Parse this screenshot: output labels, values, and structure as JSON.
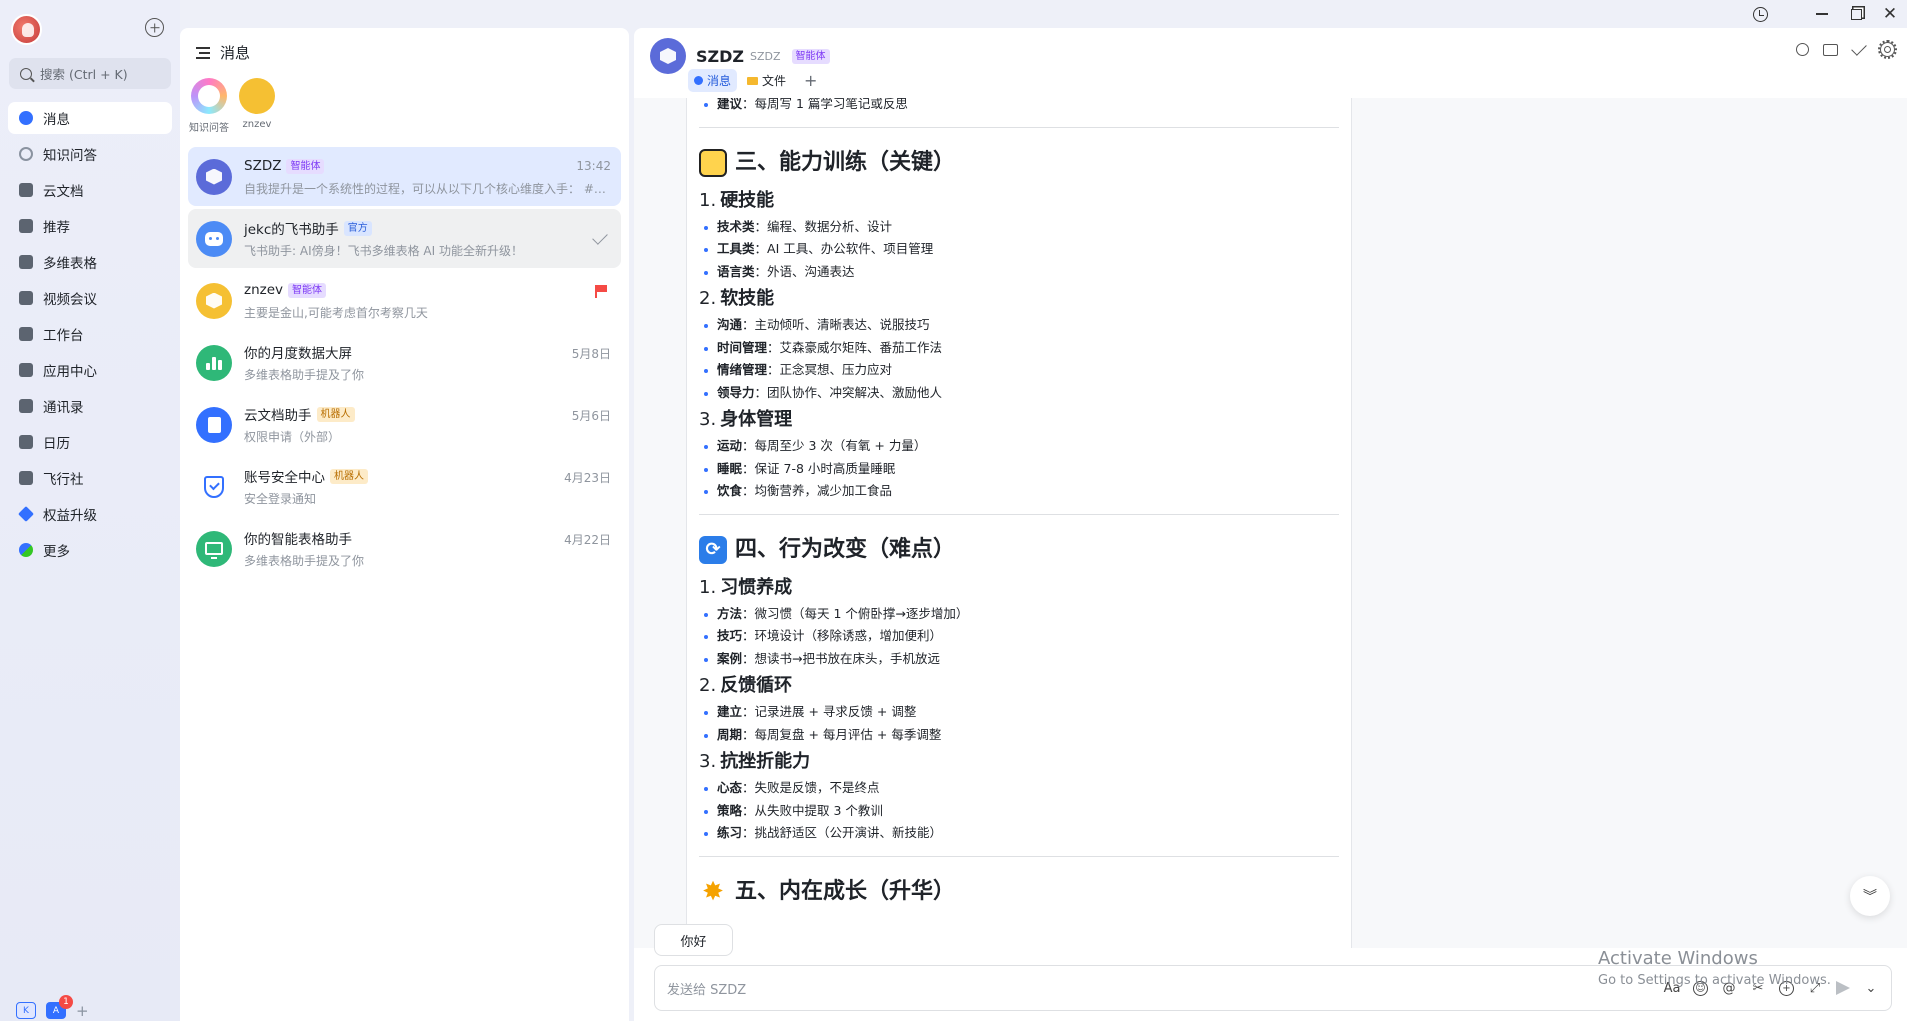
{
  "rail": {
    "search_placeholder": "搜索 (Ctrl + K)",
    "nav": [
      {
        "label": "消息",
        "icon": "chat-bubble-icon",
        "active": true
      },
      {
        "label": "知识问答",
        "icon": "knowledge-icon"
      },
      {
        "label": "云文档",
        "icon": "cloud-doc-icon"
      },
      {
        "label": "推荐",
        "icon": "recommend-icon"
      },
      {
        "label": "多维表格",
        "icon": "base-table-icon"
      },
      {
        "label": "视频会议",
        "icon": "video-meeting-icon"
      },
      {
        "label": "工作台",
        "icon": "workplace-icon"
      },
      {
        "label": "应用中心",
        "icon": "app-center-icon"
      },
      {
        "label": "通讯录",
        "icon": "contacts-icon"
      },
      {
        "label": "日历",
        "icon": "calendar-icon"
      },
      {
        "label": "飞行社",
        "icon": "flight-club-icon"
      },
      {
        "label": "权益升级",
        "icon": "diamond-icon"
      },
      {
        "label": "更多",
        "icon": "more-apps-icon"
      }
    ],
    "bottom": {
      "app1": "K",
      "app2": "A",
      "app2_badge": "1"
    }
  },
  "list": {
    "title": "消息",
    "pinned": [
      {
        "label": "知识问答"
      },
      {
        "label": "znzev"
      }
    ],
    "conversations": [
      {
        "name": "SZDZ",
        "tag": "智能体",
        "tag_style": "purple",
        "time": "13:42",
        "preview": "自我提升是一个系统性的过程，可以从以下几个核心维度入手： ## 一、认知升级（基础）",
        "color": "#5b6bd9"
      },
      {
        "name": "jekc的飞书助手",
        "tag": "官方",
        "tag_style": "blue",
        "time": "",
        "preview": "飞书助手: AI傍身！飞书多维表格 AI 功能全新升级！",
        "color": "#4c8bf5"
      },
      {
        "name": "znzev",
        "tag": "智能体",
        "tag_style": "purple",
        "time": "",
        "preview": "主要是金山,可能考虑首尔考察几天",
        "color": "#f5c033"
      },
      {
        "name": "你的月度数据大屏",
        "tag": "",
        "tag_style": "",
        "time": "5月8日",
        "preview": "多维表格助手提及了你",
        "color": "#2fb878"
      },
      {
        "name": "云文档助手",
        "tag": "机器人",
        "tag_style": "orange",
        "time": "5月6日",
        "preview": "权限申请（外部）",
        "color": "#3370ff"
      },
      {
        "name": "账号安全中心",
        "tag": "机器人",
        "tag_style": "orange",
        "time": "4月23日",
        "preview": "安全登录通知",
        "color": "#ffffff"
      },
      {
        "name": "你的智能表格助手",
        "tag": "",
        "tag_style": "",
        "time": "4月22日",
        "preview": "多维表格助手提及了你",
        "color": "#2fb878"
      }
    ]
  },
  "chat": {
    "name": "SZDZ",
    "id": "SZDZ",
    "tag": "智能体",
    "tabs": {
      "messages": "消息",
      "files": "文件"
    },
    "doc": {
      "top_item": {
        "k": "建议",
        "v": "：每周写 1 篇学习笔记或反思"
      },
      "s3": {
        "title": "三、能力训练（关键）"
      },
      "s3a": {
        "num": "1.",
        "title": "硬技能"
      },
      "s3a_items": [
        {
          "k": "技术类",
          "v": "：编程、数据分析、设计"
        },
        {
          "k": "工具类",
          "v": "：AI 工具、办公软件、项目管理"
        },
        {
          "k": "语言类",
          "v": "：外语、沟通表达"
        }
      ],
      "s3b": {
        "num": "2.",
        "title": "软技能"
      },
      "s3b_items": [
        {
          "k": "沟通",
          "v": "：主动倾听、清晰表达、说服技巧"
        },
        {
          "k": "时间管理",
          "v": "：艾森豪威尔矩阵、番茄工作法"
        },
        {
          "k": "情绪管理",
          "v": "：正念冥想、压力应对"
        },
        {
          "k": "领导力",
          "v": "：团队协作、冲突解决、激励他人"
        }
      ],
      "s3c": {
        "num": "3.",
        "title": "身体管理"
      },
      "s3c_items": [
        {
          "k": "运动",
          "v": "：每周至少 3 次（有氧 + 力量）"
        },
        {
          "k": "睡眠",
          "v": "：保证 7-8 小时高质量睡眠"
        },
        {
          "k": "饮食",
          "v": "：均衡营养，减少加工食品"
        }
      ],
      "s4": {
        "title": "四、行为改变（难点）"
      },
      "s4a": {
        "num": "1.",
        "title": "习惯养成"
      },
      "s4a_items": [
        {
          "k": "方法",
          "v": "：微习惯（每天 1 个俯卧撑→逐步增加）"
        },
        {
          "k": "技巧",
          "v": "：环境设计（移除诱惑，增加便利）"
        },
        {
          "k": "案例",
          "v": "：想读书→把书放在床头，手机放远"
        }
      ],
      "s4b": {
        "num": "2.",
        "title": "反馈循环"
      },
      "s4b_items": [
        {
          "k": "建立",
          "v": "：记录进展 + 寻求反馈 + 调整"
        },
        {
          "k": "周期",
          "v": "：每周复盘 + 每月评估 + 每季调整"
        }
      ],
      "s4c": {
        "num": "3.",
        "title": "抗挫折能力"
      },
      "s4c_items": [
        {
          "k": "心态",
          "v": "：失败是反馈，不是终点"
        },
        {
          "k": "策略",
          "v": "：从失败中提取 3 个教训"
        },
        {
          "k": "练习",
          "v": "：挑战舒适区（公开演讲、新技能）"
        }
      ],
      "s5": {
        "title": "五、内在成长（升华）"
      }
    },
    "quick_reply": "你好",
    "composer_placeholder": "发送给 SZDZ"
  },
  "watermark": {
    "line1": "Activate Windows",
    "line2": "Go to Settings to activate Windows."
  }
}
